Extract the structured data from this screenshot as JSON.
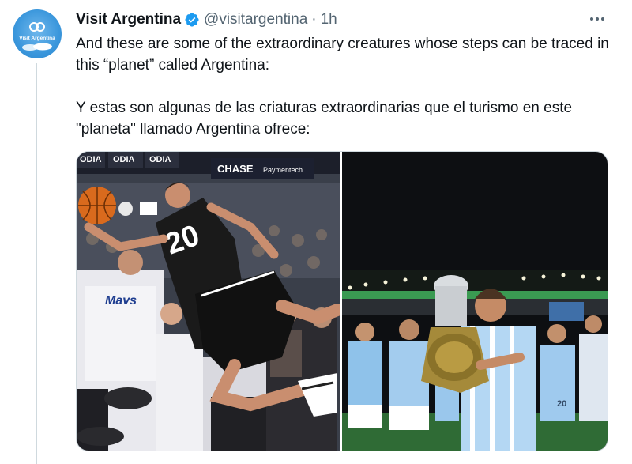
{
  "tweet": {
    "display_name": "Visit Argentina",
    "handle": "@visitargentina",
    "separator": "·",
    "time": "1h",
    "avatar_label": "Visit Argentina",
    "text_en": "And these are some of the extraordinary creatures whose steps can be traced in this “planet” called Argentina:",
    "text_es": "Y estas son algunas de las criaturas extraordinarias que el turismo en este \"planeta\" llamado Argentina ofrece:"
  },
  "media": {
    "left_photo": {
      "banner_brand_1": "ODIA",
      "banner_brand_2": "ODIA",
      "banner_brand_3": "ODIA",
      "banner_sponsor": "CHASE",
      "banner_sponsor_sub": "Paymentech",
      "jersey_number": "20",
      "fan_shirt": "Mavs"
    },
    "right_photo": {
      "jersey_number": "20"
    }
  },
  "colors": {
    "verified": "#1d9bf0",
    "text_primary": "#0f1419",
    "text_secondary": "#536471",
    "thread_line": "#cfd9de"
  },
  "icons": {
    "verified": "verified-badge-icon",
    "more": "more-options-icon"
  }
}
